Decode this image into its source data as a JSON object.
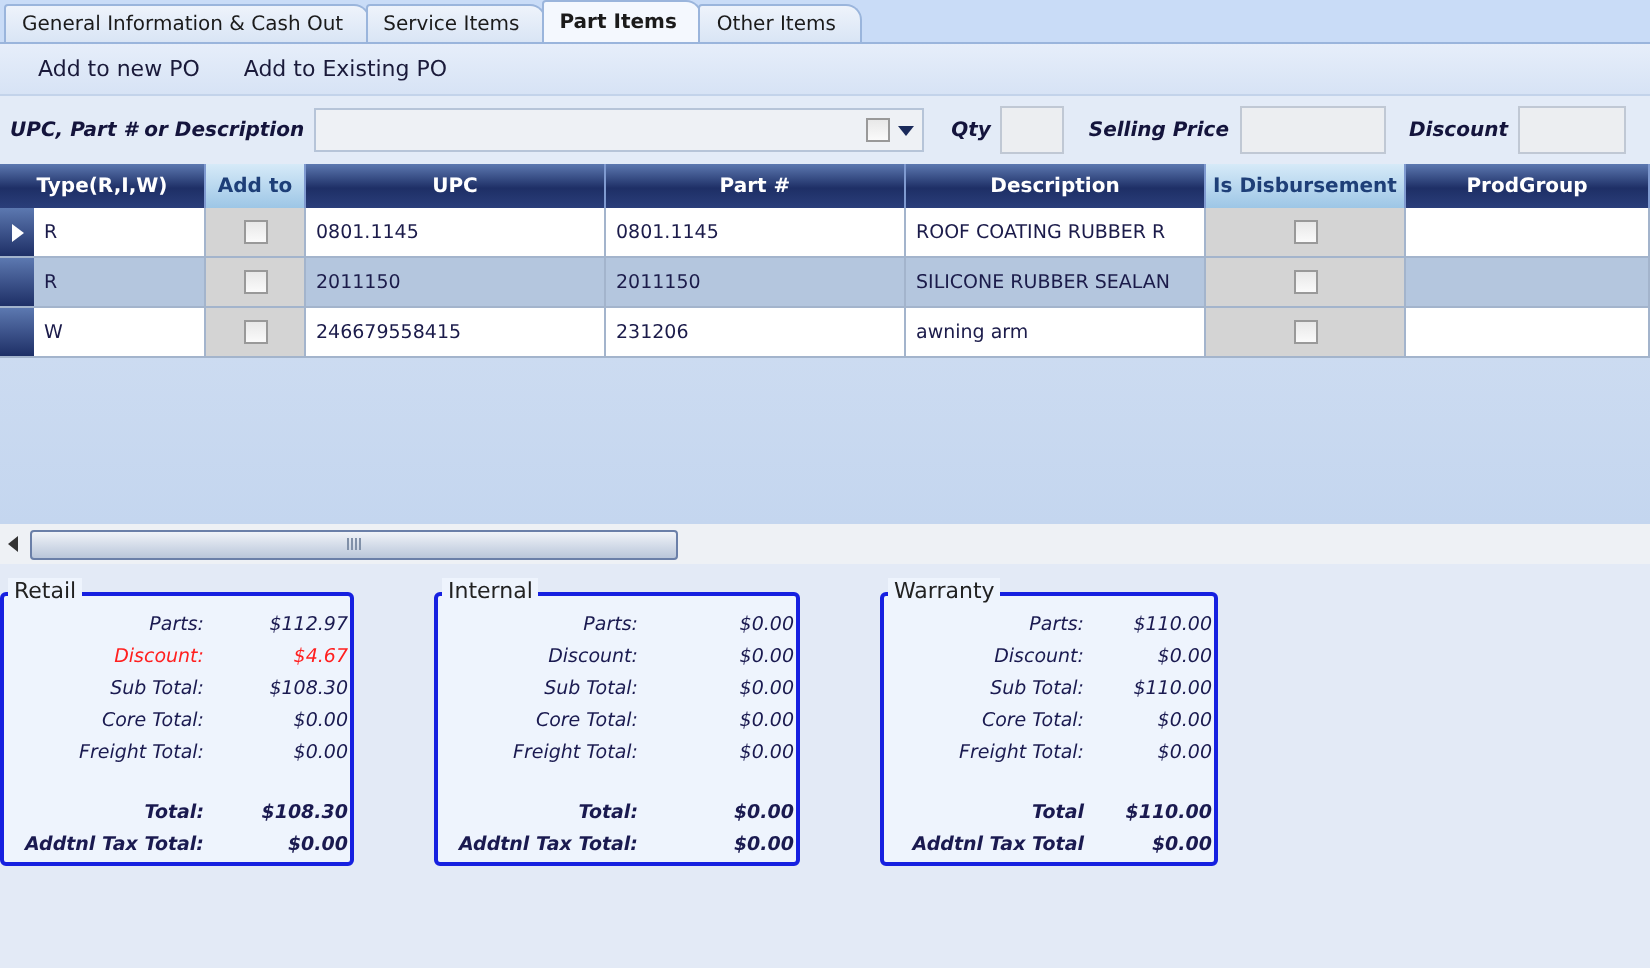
{
  "tabs": [
    {
      "label": "General Information & Cash Out",
      "selected": false
    },
    {
      "label": "Service Items",
      "selected": false
    },
    {
      "label": "Part Items",
      "selected": true
    },
    {
      "label": "Other Items",
      "selected": false
    }
  ],
  "toolbar": [
    "Add to new PO",
    "Add to Existing PO"
  ],
  "search": {
    "label": "UPC, Part # or Description",
    "checked": false,
    "qty_label": "Qty",
    "price_label": "Selling Price",
    "discount_label": "Discount"
  },
  "grid": {
    "columns": [
      {
        "label": "Type(R,I,W)",
        "highlighted": false
      },
      {
        "label": "Add to",
        "highlighted": true
      },
      {
        "label": "UPC",
        "highlighted": false
      },
      {
        "label": "Part #",
        "highlighted": false
      },
      {
        "label": "Description",
        "highlighted": false
      },
      {
        "label": "Is Disbursement",
        "highlighted": true
      },
      {
        "label": "ProdGroup",
        "highlighted": false
      }
    ],
    "rows": [
      {
        "current": true,
        "selected": false,
        "type": "R",
        "add_to": false,
        "upc": "0801.1145",
        "part": "0801.1145",
        "description": "ROOF COATING RUBBER R",
        "is_disbursement": false
      },
      {
        "current": false,
        "selected": true,
        "type": "R",
        "add_to": false,
        "upc": "2011150",
        "part": "2011150",
        "description": "SILICONE RUBBER SEALAN",
        "is_disbursement": false
      },
      {
        "current": false,
        "selected": false,
        "type": "W",
        "add_to": false,
        "upc": "246679558415",
        "part": "231206",
        "description": "awning arm",
        "is_disbursement": false
      }
    ]
  },
  "summaries": [
    {
      "title": "Retail",
      "lines": [
        {
          "label": "Parts:",
          "value": "$112.97",
          "kind": "normal"
        },
        {
          "label": "Discount:",
          "value": "$4.67",
          "kind": "discount"
        },
        {
          "label": "Sub Total:",
          "value": "$108.30",
          "kind": "normal"
        },
        {
          "label": "Core Total:",
          "value": "$0.00",
          "kind": "normal"
        },
        {
          "label": "Freight Total:",
          "value": "$0.00",
          "kind": "normal"
        },
        {
          "label": "Total:",
          "value": "$108.30",
          "kind": "total"
        },
        {
          "label": "Addtnl Tax Total:",
          "value": "$0.00",
          "kind": "total"
        }
      ]
    },
    {
      "title": "Internal",
      "lines": [
        {
          "label": "Parts:",
          "value": "$0.00",
          "kind": "normal"
        },
        {
          "label": "Discount:",
          "value": "$0.00",
          "kind": "normal"
        },
        {
          "label": "Sub Total:",
          "value": "$0.00",
          "kind": "normal"
        },
        {
          "label": "Core Total:",
          "value": "$0.00",
          "kind": "normal"
        },
        {
          "label": "Freight Total:",
          "value": "$0.00",
          "kind": "normal"
        },
        {
          "label": "Total:",
          "value": "$0.00",
          "kind": "total"
        },
        {
          "label": "Addtnl Tax Total:",
          "value": "$0.00",
          "kind": "total"
        }
      ]
    },
    {
      "title": "Warranty",
      "lines": [
        {
          "label": "Parts:",
          "value": "$110.00",
          "kind": "normal"
        },
        {
          "label": "Discount:",
          "value": "$0.00",
          "kind": "normal"
        },
        {
          "label": "Sub Total:",
          "value": "$110.00",
          "kind": "normal"
        },
        {
          "label": "Core Total:",
          "value": "$0.00",
          "kind": "normal"
        },
        {
          "label": "Freight Total:",
          "value": "$0.00",
          "kind": "normal"
        },
        {
          "label": "Total",
          "value": "$110.00",
          "kind": "total"
        },
        {
          "label": "Addtnl Tax Total",
          "value": "$0.00",
          "kind": "total"
        }
      ]
    }
  ]
}
